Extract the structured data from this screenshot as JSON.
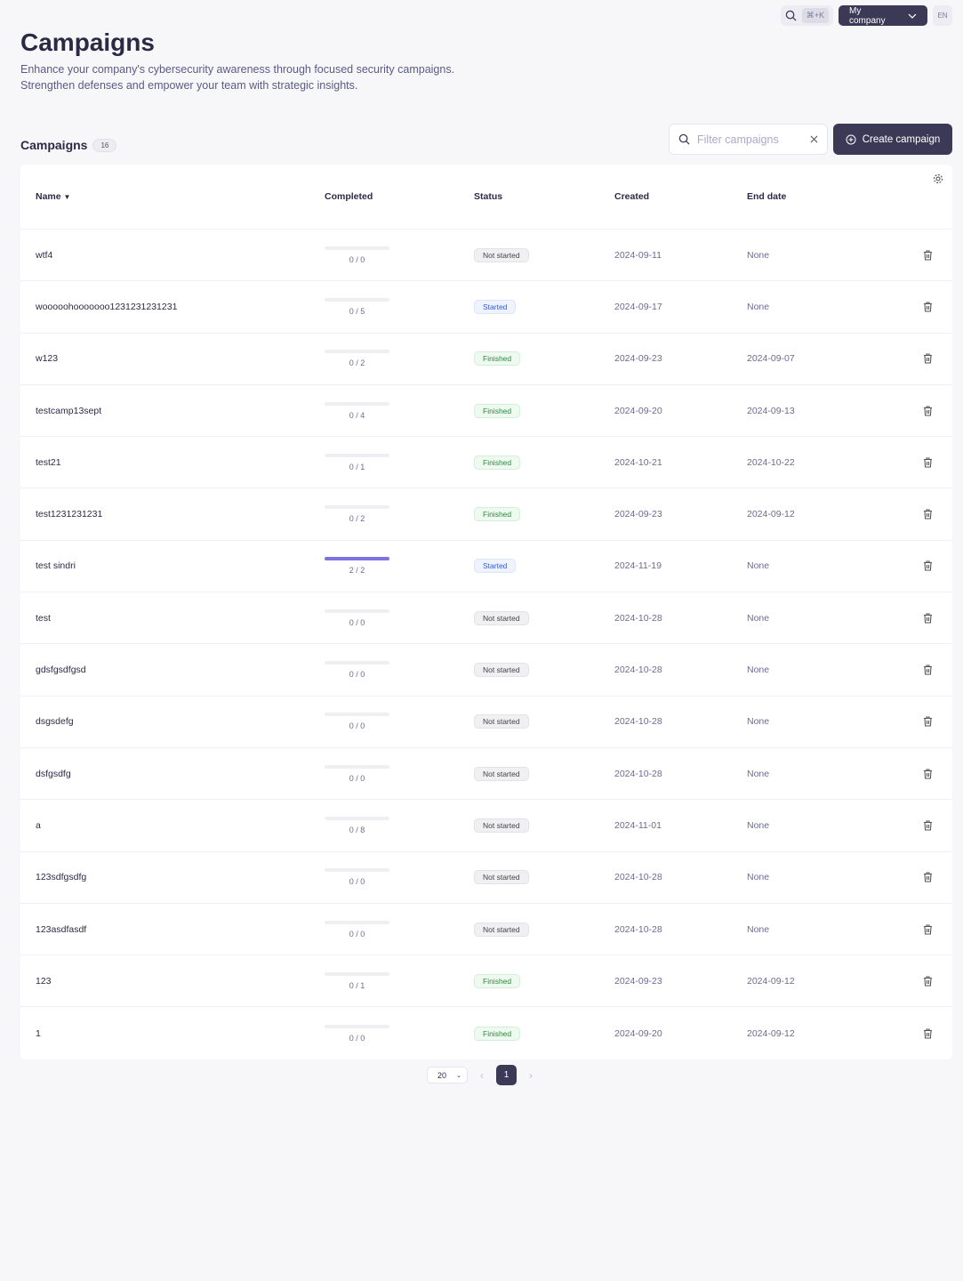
{
  "topbar": {
    "shortcut": "⌘+K",
    "company": "My company",
    "language": "EN"
  },
  "header": {
    "title": "Campaigns",
    "description": "Enhance your company's cybersecurity awareness through focused security campaigns. Strengthen defenses and empower your team with strategic insights."
  },
  "section": {
    "title": "Campaigns",
    "count": "16",
    "filter_placeholder": "Filter campaigns",
    "create_label": "Create campaign"
  },
  "columns": {
    "name": "Name",
    "completed": "Completed",
    "status": "Status",
    "created": "Created",
    "end_date": "End date"
  },
  "rows": [
    {
      "name": "wtf4",
      "done": 0,
      "total": 0,
      "completed": "0 / 0",
      "status": "Not started",
      "created": "2024-09-11",
      "end": "None"
    },
    {
      "name": "wooooohooooooo1231231231231",
      "done": 0,
      "total": 5,
      "completed": "0 / 5",
      "status": "Started",
      "created": "2024-09-17",
      "end": "None"
    },
    {
      "name": "w123",
      "done": 0,
      "total": 2,
      "completed": "0 / 2",
      "status": "Finished",
      "created": "2024-09-23",
      "end": "2024-09-07"
    },
    {
      "name": "testcamp13sept",
      "done": 0,
      "total": 4,
      "completed": "0 / 4",
      "status": "Finished",
      "created": "2024-09-20",
      "end": "2024-09-13"
    },
    {
      "name": "test21",
      "done": 0,
      "total": 1,
      "completed": "0 / 1",
      "status": "Finished",
      "created": "2024-10-21",
      "end": "2024-10-22"
    },
    {
      "name": "test1231231231",
      "done": 0,
      "total": 2,
      "completed": "0 / 2",
      "status": "Finished",
      "created": "2024-09-23",
      "end": "2024-09-12"
    },
    {
      "name": "test sindri",
      "done": 2,
      "total": 2,
      "completed": "2 / 2",
      "status": "Started",
      "created": "2024-11-19",
      "end": "None"
    },
    {
      "name": "test",
      "done": 0,
      "total": 0,
      "completed": "0 / 0",
      "status": "Not started",
      "created": "2024-10-28",
      "end": "None"
    },
    {
      "name": "gdsfgsdfgsd",
      "done": 0,
      "total": 0,
      "completed": "0 / 0",
      "status": "Not started",
      "created": "2024-10-28",
      "end": "None"
    },
    {
      "name": "dsgsdefg",
      "done": 0,
      "total": 0,
      "completed": "0 / 0",
      "status": "Not started",
      "created": "2024-10-28",
      "end": "None"
    },
    {
      "name": "dsfgsdfg",
      "done": 0,
      "total": 0,
      "completed": "0 / 0",
      "status": "Not started",
      "created": "2024-10-28",
      "end": "None"
    },
    {
      "name": "a",
      "done": 0,
      "total": 8,
      "completed": "0 / 8",
      "status": "Not started",
      "created": "2024-11-01",
      "end": "None"
    },
    {
      "name": "123sdfgsdfg",
      "done": 0,
      "total": 0,
      "completed": "0 / 0",
      "status": "Not started",
      "created": "2024-10-28",
      "end": "None"
    },
    {
      "name": "123asdfasdf",
      "done": 0,
      "total": 0,
      "completed": "0 / 0",
      "status": "Not started",
      "created": "2024-10-28",
      "end": "None"
    },
    {
      "name": "123",
      "done": 0,
      "total": 1,
      "completed": "0 / 1",
      "status": "Finished",
      "created": "2024-09-23",
      "end": "2024-09-12"
    },
    {
      "name": "1",
      "done": 0,
      "total": 0,
      "completed": "0 / 0",
      "status": "Finished",
      "created": "2024-09-20",
      "end": "2024-09-12"
    }
  ],
  "pagination": {
    "page_size": "20",
    "current_page": "1"
  },
  "colors": {
    "primary": "#3b3956",
    "progress": "#7b74e0"
  }
}
